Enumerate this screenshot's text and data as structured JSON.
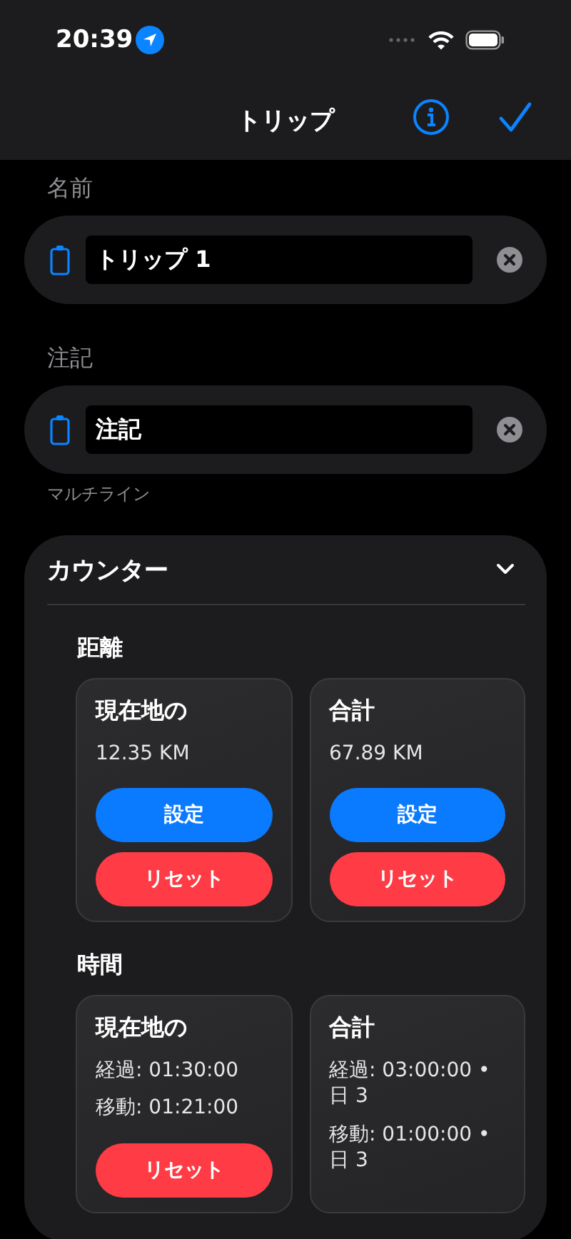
{
  "status_bar": {
    "time": "20:39"
  },
  "nav": {
    "title": "トリップ"
  },
  "fields": [
    {
      "label": "名前",
      "value": "トリップ 1"
    },
    {
      "label": "注記",
      "value": "注記",
      "footnote": "マルチライン"
    }
  ],
  "counter": {
    "title": "カウンター",
    "expanded": true,
    "sections": [
      {
        "title": "距離",
        "cards": [
          {
            "title": "現在地の",
            "lines": [
              "12.35 KM"
            ],
            "buttons": [
              {
                "label": "設定",
                "kind": "set"
              },
              {
                "label": "リセット",
                "kind": "reset"
              }
            ]
          },
          {
            "title": "合計",
            "lines": [
              "67.89 KM"
            ],
            "buttons": [
              {
                "label": "設定",
                "kind": "set"
              },
              {
                "label": "リセット",
                "kind": "reset"
              }
            ]
          }
        ]
      },
      {
        "title": "時間",
        "cards": [
          {
            "title": "現在地の",
            "lines": [
              "経過: 01:30:00",
              "移動: 01:21:00"
            ],
            "buttons": [
              {
                "label": "リセット",
                "kind": "reset"
              }
            ]
          },
          {
            "title": "合計",
            "lines": [
              "経過: 03:00:00 • 日 3",
              "移動: 01:00:00 • 日 3"
            ]
          }
        ]
      }
    ]
  }
}
